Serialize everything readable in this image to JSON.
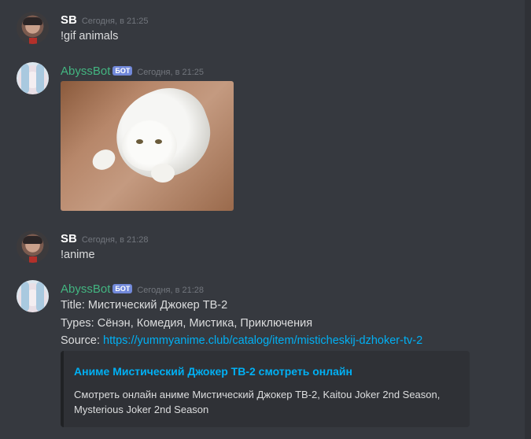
{
  "messages": [
    {
      "author": "SB",
      "time": "Сегодня, в 21:25",
      "text": "!gif animals"
    },
    {
      "author": "AbyssBot",
      "badge": "БОТ",
      "time": "Сегодня, в 21:25",
      "attachment": "gif-cat-image"
    },
    {
      "author": "SB",
      "time": "Сегодня, в 21:28",
      "text": "!anime"
    },
    {
      "author": "AbyssBot",
      "badge": "БОТ",
      "time": "Сегодня, в 21:28",
      "lines": {
        "title": "Title: Мистический Джокер ТВ-2",
        "types": "Types: Сёнэн, Комедия, Мистика, Приключения",
        "source_label": "Source: ",
        "source_url": "https://yummyanime.club/catalog/item/misticheskij-dzhoker-tv-2"
      },
      "embed": {
        "title": "Аниме Мистический Джокер ТВ-2 смотреть онлайн",
        "description": "Смотреть онлайн аниме Мистический Джокер ТВ-2, Kaitou Joker 2nd Season, Mysterious Joker 2nd Season"
      }
    }
  ],
  "colors": {
    "background": "#36393f",
    "bot_name": "#43b581",
    "link": "#00b0f4",
    "badge": "#7289da"
  }
}
